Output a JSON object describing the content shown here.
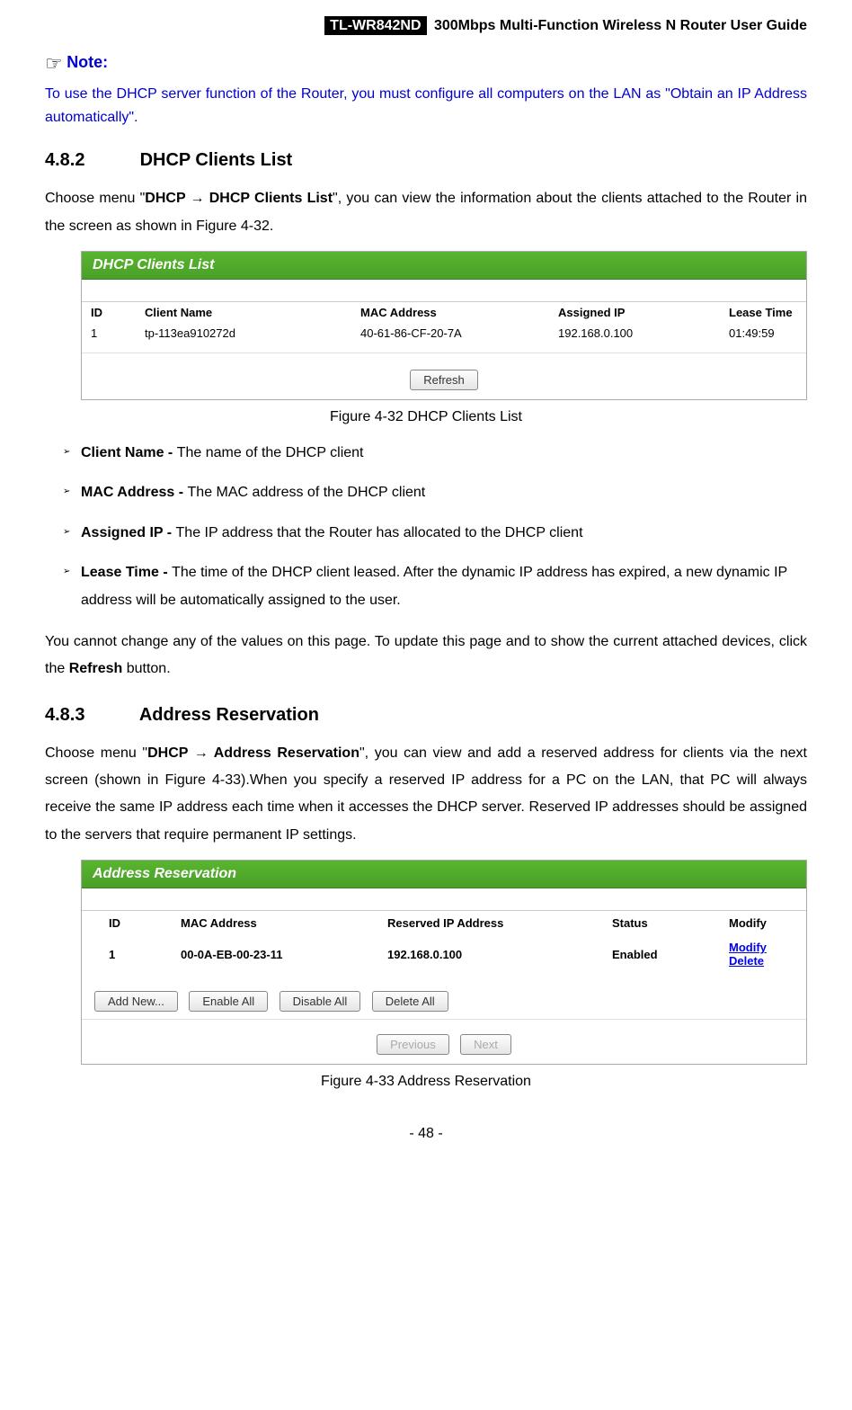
{
  "header": {
    "model": "TL-WR842ND",
    "title": "300Mbps Multi-Function Wireless N Router User Guide"
  },
  "note": {
    "label": "Note:",
    "text": "To use the DHCP server function of the Router, you must configure all computers on the LAN as \"Obtain an IP Address automatically\"."
  },
  "section1": {
    "num": "4.8.2",
    "title": "DHCP Clients List",
    "intro_pre": "Choose menu \"",
    "intro_bold": "DHCP → DHCP Clients List",
    "intro_post": "\", you can view the information about the clients attached to the Router in the screen as shown in Figure 4-32."
  },
  "figure1": {
    "title": "DHCP Clients List",
    "headers": {
      "id": "ID",
      "name": "Client Name",
      "mac": "MAC Address",
      "ip": "Assigned IP",
      "lease": "Lease Time"
    },
    "row": {
      "id": "1",
      "name": "tp-113ea910272d",
      "mac": "40-61-86-CF-20-7A",
      "ip": "192.168.0.100",
      "lease": "01:49:59"
    },
    "refresh": "Refresh",
    "caption": "Figure 4-32    DHCP Clients List"
  },
  "definitions": [
    {
      "term": "Client Name - ",
      "desc": "The name of the DHCP client"
    },
    {
      "term": "MAC Address - ",
      "desc": "The MAC address of the DHCP client"
    },
    {
      "term": "Assigned IP - ",
      "desc": "The IP address that the Router has allocated to the DHCP client"
    },
    {
      "term": "Lease Time - ",
      "desc": "The time of the DHCP client leased. After the dynamic IP address has expired, a new dynamic IP address will be automatically assigned to the user."
    }
  ],
  "para2_pre": "You cannot change any of the values on this page. To update this page and to show the current attached devices, click the ",
  "para2_bold": "Refresh",
  "para2_post": " button.",
  "section2": {
    "num": "4.8.3",
    "title": "Address Reservation",
    "intro_pre": "Choose menu \"",
    "intro_bold": "DHCP → Address Reservation",
    "intro_post": "\", you can view and add a reserved address for clients via the next screen (shown in Figure 4-33).When you specify a reserved IP address for a PC on the LAN, that PC will always receive the same IP address each time when it accesses the DHCP server. Reserved IP addresses should be assigned to the servers that require permanent IP settings."
  },
  "figure2": {
    "title": "Address Reservation",
    "headers": {
      "id": "ID",
      "mac": "MAC Address",
      "ip": "Reserved IP Address",
      "status": "Status",
      "modify": "Modify"
    },
    "row": {
      "id": "1",
      "mac": "00-0A-EB-00-23-11",
      "ip": "192.168.0.100",
      "status": "Enabled",
      "mod": "Modify",
      "del": "Delete"
    },
    "buttons": {
      "add": "Add New...",
      "enable": "Enable All",
      "disable": "Disable All",
      "delete": "Delete All",
      "prev": "Previous",
      "next": "Next"
    },
    "caption": "Figure 4-33    Address Reservation"
  },
  "pagenum": "- 48 -"
}
